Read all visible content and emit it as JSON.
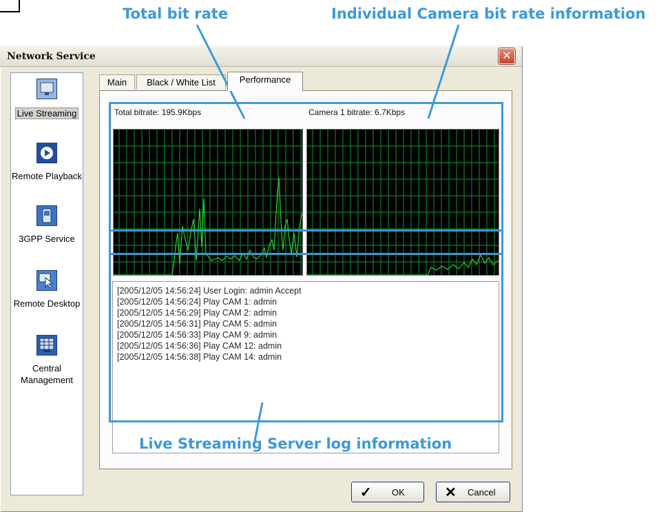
{
  "callouts": {
    "total": "Total bit rate",
    "individual": "Individual Camera bit rate information",
    "log": "Live Streaming Server log information"
  },
  "window": {
    "title": "Network Service",
    "close_glyph": "✕"
  },
  "sidebar": {
    "items": [
      {
        "label": "Live Streaming",
        "icon": "monitor-icon",
        "selected": true
      },
      {
        "label": "Remote Playback",
        "icon": "play-icon",
        "selected": false
      },
      {
        "label": "3GPP Service",
        "icon": "mobile-phone-icon",
        "selected": false
      },
      {
        "label": "Remote Desktop",
        "icon": "remote-desktop-icon",
        "selected": false
      },
      {
        "label": "Central Management",
        "icon": "grid-monitor-icon",
        "selected": false
      }
    ]
  },
  "tabs": [
    {
      "label": "Main",
      "active": false
    },
    {
      "label": "Black / White List",
      "active": false
    },
    {
      "label": "Performance",
      "active": true
    }
  ],
  "performance": {
    "total_label": "Total bitrate: 195.9Kbps",
    "camera_label": "Camera 1 bitrate: 6.7Kbps"
  },
  "log": [
    "[2005/12/05 14:56:24]  User Login: admin Accept",
    "[2005/12/05 14:56:24]  Play CAM 1: admin",
    "[2005/12/05 14:56:29]  Play CAM 2: admin",
    "[2005/12/05 14:56:31]  Play CAM 5: admin",
    "[2005/12/05 14:56:33]  Play CAM 9: admin",
    "[2005/12/05 14:56:36]  Play CAM 12: admin",
    "[2005/12/05 14:56:38]  Play CAM 14: admin"
  ],
  "buttons": {
    "ok": "OK",
    "ok_glyph": "✓",
    "cancel": "Cancel",
    "cancel_glyph": "✕"
  },
  "colors": {
    "callout": "#3a9ad9",
    "graph_line": "#2fd22f",
    "graph_grid": "#0b7f2e",
    "graph_bg": "#000000"
  }
}
